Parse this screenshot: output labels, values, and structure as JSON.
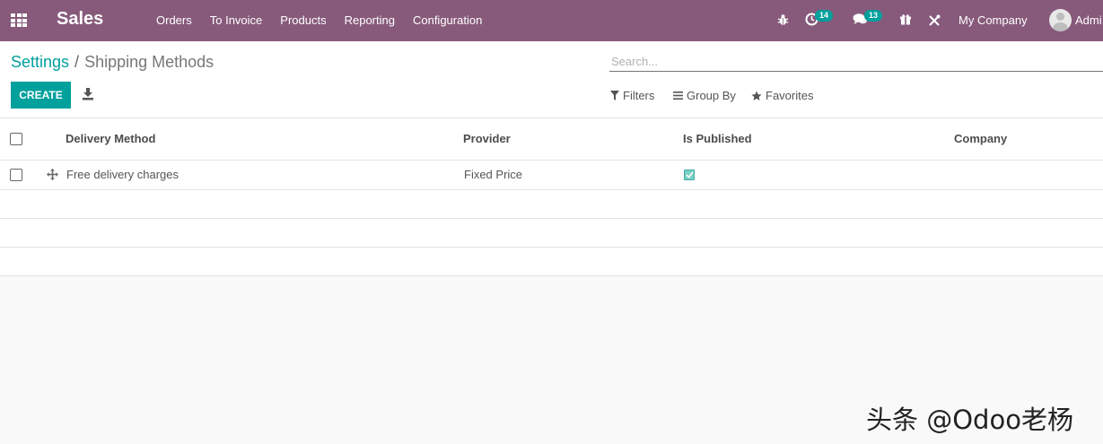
{
  "navbar": {
    "app_name": "Sales",
    "menu": [
      "Orders",
      "To Invoice",
      "Products",
      "Reporting",
      "Configuration"
    ],
    "activity_count": "14",
    "messages_count": "13",
    "company": "My Company",
    "user": "Admi"
  },
  "breadcrumb": {
    "parent": "Settings",
    "separator": "/",
    "current": "Shipping Methods"
  },
  "toolbar": {
    "create_label": "CREATE"
  },
  "search": {
    "placeholder": "Search..."
  },
  "search_options": {
    "filters": "Filters",
    "group_by": "Group By",
    "favorites": "Favorites"
  },
  "table": {
    "columns": [
      "Delivery Method",
      "Provider",
      "Is Published",
      "Company"
    ],
    "rows": [
      {
        "delivery_method": "Free delivery charges",
        "provider": "Fixed Price",
        "is_published": true,
        "company": ""
      }
    ]
  },
  "watermark": "头条 @Odoo老杨",
  "colors": {
    "navbar": "#875a7b",
    "accent": "#00a09d"
  }
}
